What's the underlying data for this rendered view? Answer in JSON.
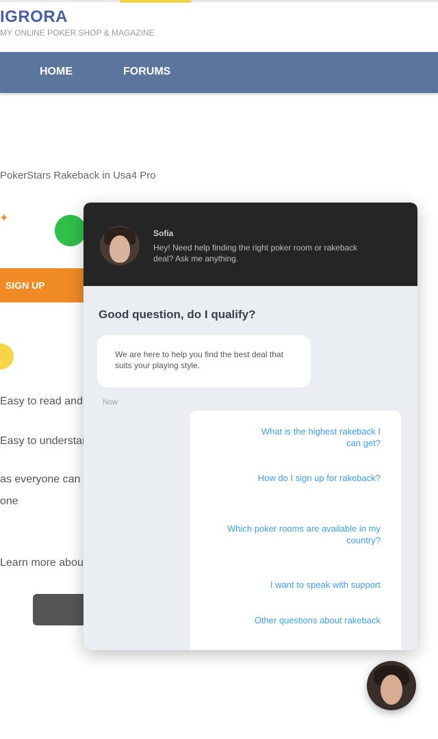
{
  "header": {
    "logo": "IGRORA",
    "tagline": "MY ONLINE POKER SHOP & MAGAZINE"
  },
  "nav": {
    "items": [
      "HOME",
      "FORUMS"
    ]
  },
  "page": {
    "breadcrumb": "PokerStars Rakeback in Usa4 Pro",
    "orange_bar_label": "SIGN UP",
    "lines": [
      "Easy to read and",
      "Easy to understand",
      "as everyone can",
      "one"
    ],
    "footer_line": "Learn more about us"
  },
  "chat": {
    "agent_name": "Sofia",
    "agent_subtitle": "Hey! Need help finding the right poker room or rakeback deal? Ask me anything.",
    "question": "Good question, do I qualify?",
    "bot_message": "We are here to help you find the best deal that suits your playing style.",
    "timestamp": "Now",
    "options": [
      "What is the highest rakeback I can get?",
      "How do I sign up for rakeback?",
      "Which poker rooms are available in my country?",
      "I want to speak with support",
      "Other questions about rakeback"
    ],
    "colors": {
      "header_bg": "#252525",
      "option_text": "#3a9ef0",
      "panel_bg": "#eaedf2"
    }
  },
  "fab": {
    "icon": "agent-avatar-icon"
  }
}
